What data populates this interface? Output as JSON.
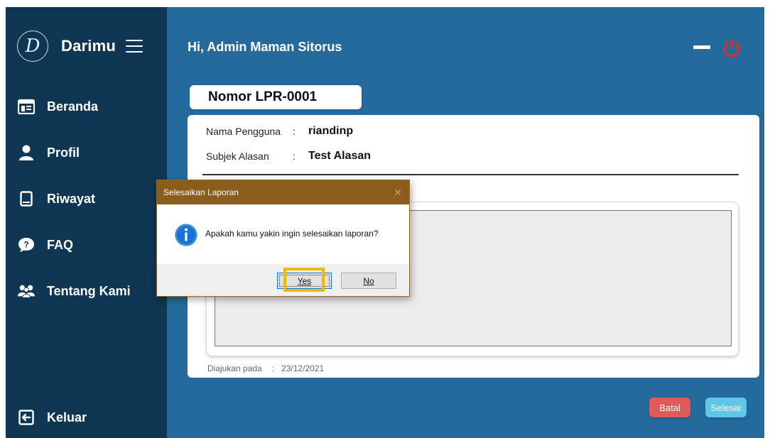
{
  "brand": {
    "name": "Darimu",
    "logo_letter": "D"
  },
  "sidebar": {
    "items": [
      {
        "label": "Beranda",
        "icon": "calendar-icon"
      },
      {
        "label": "Profil",
        "icon": "user-icon"
      },
      {
        "label": "Riwayat",
        "icon": "book-icon"
      },
      {
        "label": "FAQ",
        "icon": "question-bubble-icon"
      },
      {
        "label": "Tentang Kami",
        "icon": "users-icon"
      }
    ],
    "logout": {
      "label": "Keluar",
      "icon": "logout-icon"
    }
  },
  "header": {
    "greeting": "Hi, Admin Maman Sitorus"
  },
  "report": {
    "number": "Nomor LPR-0001",
    "user_label": "Nama Pengguna",
    "user_value": "riandinp",
    "subject_label": "Subjek Alasan",
    "subject_value": "Test Alasan",
    "colon": ":",
    "submitted_label": "Diajukan pada",
    "submitted_value": "23/12/2021"
  },
  "actions": {
    "cancel": "Batal",
    "finish": "Selesai"
  },
  "dialog": {
    "title": "Selesaikan Laporan",
    "message": "Apakah kamu yakin ingin selesaikan laporan?",
    "yes_label": "Yes",
    "no_label": "No"
  },
  "colors": {
    "sidebar": "#0f3653",
    "main": "#256a9c",
    "power": "#e02b2b",
    "cancel": "#e05a5a",
    "finish": "#5ec6e6",
    "dialog_title": "#8a5d1c",
    "highlight": "#f5b800"
  }
}
